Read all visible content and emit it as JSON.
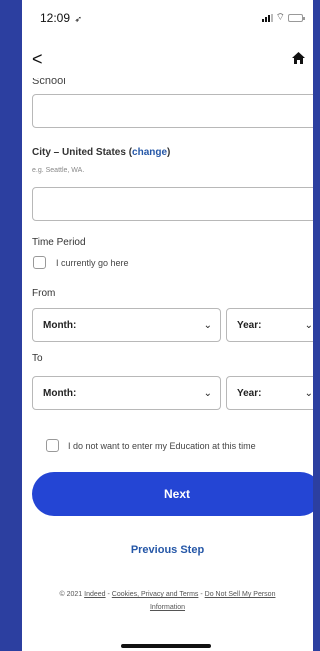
{
  "status_bar": {
    "time": "12:09",
    "location_glyph": "➶",
    "wifi_glyph": "⌔"
  },
  "nav": {
    "back_glyph": "<",
    "home_glyph": "⌂"
  },
  "form": {
    "school_label_cut": "School",
    "city_label_prefix": "City – United States (",
    "city_change_link": "change",
    "city_label_suffix": ")",
    "city_hint": "e.g. Seattle, WA.",
    "time_period_label": "Time Period",
    "currently_go_here_label": "I currently go here",
    "from_label": "From",
    "to_label": "To",
    "from_month": "Month:",
    "from_year": "Year:",
    "to_month": "Month:",
    "to_year": "Year:",
    "chevron_glyph": "⌄",
    "skip_education_label": "I do not want to enter my Education at this time"
  },
  "actions": {
    "next_label": "Next",
    "previous_label": "Previous Step"
  },
  "footer": {
    "copyright": "© 2021 ",
    "indeed_link": "Indeed",
    "sep1": " - ",
    "cookies_link": "Cookies, Privacy and Terms",
    "sep2": " - ",
    "do_not_sell_link": "Do Not Sell My Person",
    "information_link": "Information"
  }
}
